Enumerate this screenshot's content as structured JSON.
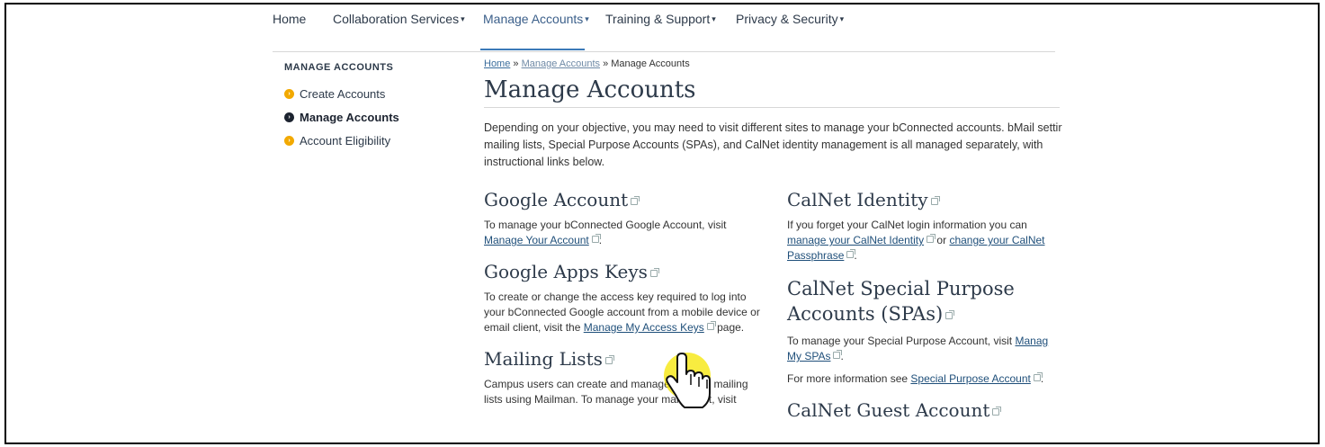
{
  "nav": {
    "items": [
      {
        "label": "Home",
        "caret": false
      },
      {
        "label": "Collaboration Services",
        "caret": true
      },
      {
        "label": "Manage Accounts",
        "caret": true
      },
      {
        "label": "Training & Support",
        "caret": true
      },
      {
        "label": "Privacy & Security",
        "caret": true
      }
    ]
  },
  "sidebar": {
    "title": "MANAGE ACCOUNTS",
    "items": [
      {
        "label": "Create Accounts",
        "active": false
      },
      {
        "label": "Manage Accounts",
        "active": true
      },
      {
        "label": "Account Eligibility",
        "active": false
      }
    ]
  },
  "breadcrumb": {
    "home": "Home",
    "sep": " » ",
    "parent": "Manage Accounts",
    "current": "Manage Accounts"
  },
  "main": {
    "title": "Manage Accounts",
    "intro_1": "Depending on your objective, you may need to visit different sites to manage your bConnected accounts. bMail settir",
    "intro_2": "mailing lists, Special Purpose Accounts (SPAs), and CalNet identity management is all managed separately, with",
    "intro_3": "instructional links below."
  },
  "left": {
    "google_account": {
      "title": "Google Account",
      "text": "To manage your bConnected Google Account, visit",
      "link": "Manage Your Account",
      "tail": "."
    },
    "apps_keys": {
      "title": "Google Apps Keys",
      "text_1": "To create or change the access key required to log into",
      "text_2": "your bConnected Google account from a mobile device or",
      "text_3": "email client, visit the",
      "link": "Manage My Access Keys",
      "tail": " page."
    },
    "mailing": {
      "title": "Mailing Lists",
      "text_1": "Campus users can create and manage",
      "text_1b": "own mailing",
      "text_2": "lists using Mailman. To manage your mailing list, visit"
    }
  },
  "right": {
    "identity": {
      "title": "CalNet Identity",
      "text": "If you forget your CalNet login information you can",
      "link_1": "manage your CalNet Identity",
      "mid": " or ",
      "link_2a": "change your CalNet",
      "link_2b": "Passphrase",
      "tail": "."
    },
    "spa": {
      "title_1": "CalNet Special Purpose",
      "title_2": "Accounts (SPAs)",
      "text": "To manage your Special Purpose Account, visit",
      "link_a": "Manag",
      "link_b": "My SPAs",
      "tail": ".",
      "more": "For more information see",
      "more_link": "Special Purpose Account",
      "more_tail": "."
    },
    "guest": {
      "title": "CalNet Guest Account"
    }
  },
  "colors": {
    "accent": "#3b7ab8",
    "bullet": "#f2a900",
    "cursor_highlight": "#f5e600"
  },
  "cursor_icon": "hand-pointer-icon"
}
